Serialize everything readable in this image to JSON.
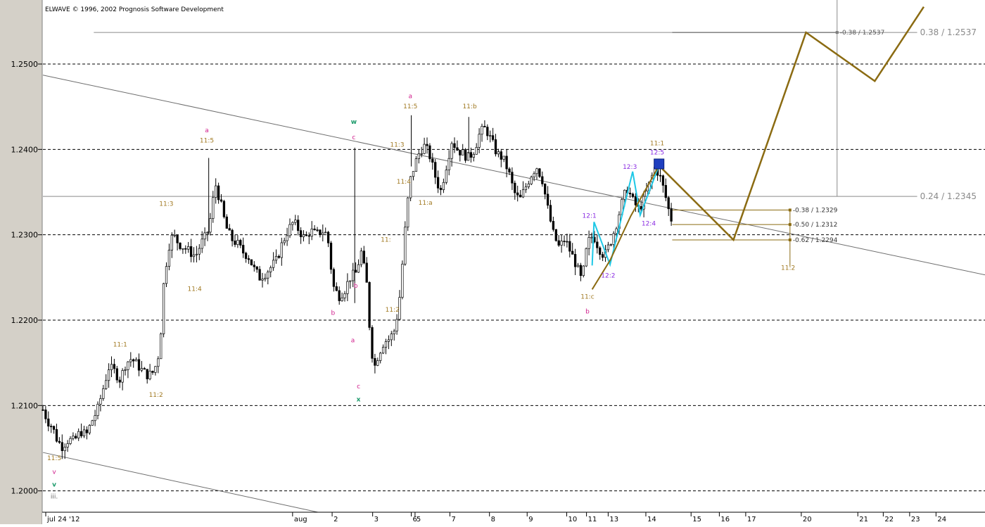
{
  "header": {
    "copyright": "ELWAVE © 1996, 2002 Prognosis Software Development"
  },
  "colors": {
    "candle": "#000000",
    "grid": "#000000",
    "trend": "#6e6e6e",
    "fib": "#8a8a8a",
    "projection": "#8b6b12",
    "impulse_cyan": "#1ec8e6",
    "label_gold": "#a07820",
    "label_magenta": "#d01c8b",
    "label_green": "#1a9a6a",
    "label_purple": "#8a2be2",
    "marker": "#1f3fbf",
    "axis_panel": "#d4d0c8"
  },
  "chart_data": {
    "type": "candlestick",
    "ylim": [
      1.1975,
      1.2575
    ],
    "xlim": [
      0,
      100
    ],
    "grid": "dashed horizontal at y ticks",
    "y_ticks": [
      {
        "value": 1.25,
        "label": "1.2500"
      },
      {
        "value": 1.24,
        "label": "1.2400"
      },
      {
        "value": 1.23,
        "label": "1.2300"
      },
      {
        "value": 1.22,
        "label": "1.2200"
      },
      {
        "value": 1.21,
        "label": "1.2100"
      },
      {
        "value": 1.2,
        "label": "1.2000"
      }
    ],
    "x_ticks": [
      {
        "x": 0.3,
        "label": "jul 24 '12"
      },
      {
        "x": 26.5,
        "label": "aug"
      },
      {
        "x": 30.7,
        "label": "2"
      },
      {
        "x": 35.0,
        "label": "3"
      },
      {
        "x": 39.1,
        "label": "6"
      },
      {
        "x": 39.5,
        "label": "5"
      },
      {
        "x": 43.2,
        "label": "7"
      },
      {
        "x": 47.4,
        "label": "8"
      },
      {
        "x": 51.4,
        "label": "9"
      },
      {
        "x": 55.6,
        "label": "10"
      },
      {
        "x": 57.7,
        "label": "11"
      },
      {
        "x": 60.0,
        "label": "13"
      },
      {
        "x": 64.0,
        "label": "14"
      },
      {
        "x": 68.8,
        "label": "15"
      },
      {
        "x": 71.8,
        "label": "16"
      },
      {
        "x": 74.6,
        "label": "17"
      },
      {
        "x": 80.5,
        "label": "20"
      },
      {
        "x": 86.5,
        "label": "21"
      },
      {
        "x": 89.2,
        "label": "22"
      },
      {
        "x": 92.0,
        "label": "23"
      },
      {
        "x": 94.8,
        "label": "24"
      }
    ],
    "price_path": [
      [
        0.0,
        1.2095
      ],
      [
        0.5,
        1.2082
      ],
      [
        1.0,
        1.2075
      ],
      [
        1.5,
        1.206
      ],
      [
        2.0,
        1.2052
      ],
      [
        2.7,
        1.206
      ],
      [
        3.3,
        1.2058
      ],
      [
        4.0,
        1.207
      ],
      [
        4.6,
        1.2065
      ],
      [
        5.2,
        1.2082
      ],
      [
        5.8,
        1.2095
      ],
      [
        6.4,
        1.212
      ],
      [
        7.0,
        1.2145
      ],
      [
        7.6,
        1.214
      ],
      [
        8.2,
        1.213
      ],
      [
        8.8,
        1.215
      ],
      [
        9.4,
        1.2155
      ],
      [
        10.0,
        1.2148
      ],
      [
        10.6,
        1.214
      ],
      [
        11.2,
        1.2135
      ],
      [
        11.8,
        1.214
      ],
      [
        12.4,
        1.2165
      ],
      [
        12.8,
        1.224
      ],
      [
        13.3,
        1.2285
      ],
      [
        13.8,
        1.23
      ],
      [
        14.4,
        1.229
      ],
      [
        15.0,
        1.2285
      ],
      [
        15.6,
        1.228
      ],
      [
        16.2,
        1.2275
      ],
      [
        16.8,
        1.229
      ],
      [
        17.4,
        1.23
      ],
      [
        17.8,
        1.232
      ],
      [
        18.3,
        1.236
      ],
      [
        18.8,
        1.234
      ],
      [
        19.4,
        1.231
      ],
      [
        20.0,
        1.2295
      ],
      [
        20.6,
        1.229
      ],
      [
        21.2,
        1.228
      ],
      [
        21.8,
        1.2275
      ],
      [
        22.4,
        1.226
      ],
      [
        23.0,
        1.225
      ],
      [
        23.6,
        1.2255
      ],
      [
        24.2,
        1.2262
      ],
      [
        24.8,
        1.227
      ],
      [
        25.4,
        1.229
      ],
      [
        26.0,
        1.2305
      ],
      [
        26.6,
        1.2315
      ],
      [
        27.2,
        1.2305
      ],
      [
        27.8,
        1.2295
      ],
      [
        28.4,
        1.2305
      ],
      [
        29.0,
        1.23
      ],
      [
        29.6,
        1.2305
      ],
      [
        30.2,
        1.23
      ],
      [
        30.8,
        1.224
      ],
      [
        31.4,
        1.2228
      ],
      [
        32.0,
        1.2235
      ],
      [
        32.6,
        1.225
      ],
      [
        33.2,
        1.2255
      ],
      [
        33.8,
        1.228
      ],
      [
        34.4,
        1.224
      ],
      [
        34.8,
        1.217
      ],
      [
        35.2,
        1.2145
      ],
      [
        35.6,
        1.216
      ],
      [
        36.2,
        1.2175
      ],
      [
        36.8,
        1.2178
      ],
      [
        37.4,
        1.219
      ],
      [
        37.9,
        1.223
      ],
      [
        38.4,
        1.23
      ],
      [
        38.9,
        1.236
      ],
      [
        39.4,
        1.238
      ],
      [
        39.9,
        1.2395
      ],
      [
        40.4,
        1.2405
      ],
      [
        41.0,
        1.2395
      ],
      [
        41.6,
        1.237
      ],
      [
        42.2,
        1.235
      ],
      [
        42.8,
        1.238
      ],
      [
        43.4,
        1.241
      ],
      [
        44.0,
        1.24
      ],
      [
        44.6,
        1.2395
      ],
      [
        45.2,
        1.239
      ],
      [
        45.8,
        1.24
      ],
      [
        46.4,
        1.242
      ],
      [
        47.0,
        1.2425
      ],
      [
        47.6,
        1.241
      ],
      [
        48.2,
        1.2395
      ],
      [
        48.8,
        1.239
      ],
      [
        49.4,
        1.2375
      ],
      [
        50.0,
        1.235
      ],
      [
        50.6,
        1.234
      ],
      [
        51.2,
        1.2355
      ],
      [
        51.8,
        1.237
      ],
      [
        52.4,
        1.238
      ],
      [
        53.0,
        1.2365
      ],
      [
        53.6,
        1.233
      ],
      [
        54.2,
        1.23
      ],
      [
        54.8,
        1.2285
      ],
      [
        55.4,
        1.2295
      ],
      [
        56.0,
        1.228
      ],
      [
        56.6,
        1.2265
      ],
      [
        57.2,
        1.2245
      ],
      [
        57.8,
        1.229
      ],
      [
        58.4,
        1.23
      ],
      [
        59.0,
        1.2285
      ],
      [
        59.6,
        1.2275
      ],
      [
        60.2,
        1.229
      ],
      [
        60.8,
        1.231
      ],
      [
        61.4,
        1.2335
      ],
      [
        62.0,
        1.2355
      ],
      [
        62.6,
        1.234
      ],
      [
        63.2,
        1.233
      ],
      [
        63.8,
        1.234
      ],
      [
        64.4,
        1.236
      ],
      [
        65.0,
        1.238
      ],
      [
        65.6,
        1.2365
      ],
      [
        66.2,
        1.234
      ],
      [
        66.6,
        1.232
      ],
      [
        66.9,
        1.2315
      ]
    ],
    "trendlines": [
      {
        "name": "upper",
        "from": [
          0,
          1.2487
        ],
        "to": [
          100,
          1.2253
        ]
      },
      {
        "name": "lower",
        "from": [
          0,
          1.2045
        ],
        "to": [
          29.2,
          1.1975
        ]
      }
    ],
    "fib_levels": [
      {
        "value": 1.2537,
        "label": "0.38 / 1.2537",
        "x_from": 5.4,
        "x_to": 92.8
      },
      {
        "value": 1.2345,
        "label": "0.24 / 1.2345",
        "x_from": 0,
        "x_to": 92.8
      }
    ],
    "fib_projection_top": {
      "value": 1.2537,
      "label": "-0.38 / 1.2537",
      "x_from": 66.8,
      "x_to": 84.3,
      "box_x": 84.3
    },
    "vertical_marker": {
      "x": 84.3,
      "y_from": 1.2575,
      "y_to": 1.2345
    },
    "retracements": [
      {
        "value": 1.2329,
        "label": "-0.38 / 1.2329"
      },
      {
        "value": 1.2312,
        "label": "-0.50 / 1.2312"
      },
      {
        "value": 1.2294,
        "label": "-0.62 / 1.2294"
      }
    ],
    "retracement_span": {
      "x_from": 66.8,
      "x_to": 79.3
    },
    "retracement_bracket": {
      "x": 79.3,
      "y_from": 1.2329,
      "y_to": 1.2263
    },
    "retracement_label": {
      "x": 79.1,
      "y": 1.2259,
      "text": "11:2"
    },
    "projection_path": [
      [
        65.4,
        1.2381
      ],
      [
        73.3,
        1.2294
      ],
      [
        81.0,
        1.2537
      ],
      [
        88.3,
        1.248
      ],
      [
        93.5,
        1.2567
      ]
    ],
    "cyan_path": [
      [
        58.3,
        1.2264
      ],
      [
        58.5,
        1.2315
      ],
      [
        60.2,
        1.2265
      ],
      [
        62.6,
        1.2374
      ],
      [
        63.4,
        1.2323
      ],
      [
        65.4,
        1.2381
      ]
    ],
    "gold_path": [
      [
        58.3,
        1.2236
      ],
      [
        60.2,
        1.227
      ],
      [
        62.4,
        1.2322
      ],
      [
        65.4,
        1.2381
      ]
    ],
    "top_marker": {
      "x": 65.4,
      "y": 1.2383
    },
    "wave_labels": [
      {
        "x": 1.2,
        "y": 1.2036,
        "text": "11:5",
        "color": "gold"
      },
      {
        "x": 1.2,
        "y": 1.202,
        "text": "v",
        "color": "magenta"
      },
      {
        "x": 1.2,
        "y": 1.2005,
        "text": "v",
        "color": "green"
      },
      {
        "x": 1.2,
        "y": 1.1991,
        "text": "iii.",
        "color": "gray"
      },
      {
        "x": 8.2,
        "y": 1.2169,
        "text": "11:1",
        "color": "gold"
      },
      {
        "x": 12.0,
        "y": 1.211,
        "text": "11:2",
        "color": "gold"
      },
      {
        "x": 13.1,
        "y": 1.2334,
        "text": "11:3",
        "color": "gold"
      },
      {
        "x": 16.1,
        "y": 1.2234,
        "text": "11:4",
        "color": "gold"
      },
      {
        "x": 17.4,
        "y": 1.2408,
        "text": "11:5",
        "color": "gold"
      },
      {
        "x": 17.4,
        "y": 1.242,
        "text": "a",
        "color": "magenta"
      },
      {
        "x": 30.8,
        "y": 1.2206,
        "text": "b",
        "color": "magenta"
      },
      {
        "x": 33.0,
        "y": 1.243,
        "text": "w",
        "color": "green"
      },
      {
        "x": 33.0,
        "y": 1.2412,
        "text": "c",
        "color": "magenta"
      },
      {
        "x": 33.2,
        "y": 1.2238,
        "text": "b",
        "color": "magenta"
      },
      {
        "x": 32.9,
        "y": 1.2174,
        "text": "a",
        "color": "magenta"
      },
      {
        "x": 33.5,
        "y": 1.212,
        "text": "c",
        "color": "magenta"
      },
      {
        "x": 33.5,
        "y": 1.2105,
        "text": "x",
        "color": "green"
      },
      {
        "x": 36.4,
        "y": 1.2292,
        "text": "11:",
        "color": "gold"
      },
      {
        "x": 37.1,
        "y": 1.221,
        "text": "11:2",
        "color": "gold"
      },
      {
        "x": 37.6,
        "y": 1.2403,
        "text": "11:3",
        "color": "gold"
      },
      {
        "x": 38.3,
        "y": 1.236,
        "text": "11:4",
        "color": "gold"
      },
      {
        "x": 39.0,
        "y": 1.2448,
        "text": "11:5",
        "color": "gold"
      },
      {
        "x": 39.0,
        "y": 1.246,
        "text": "a",
        "color": "magenta"
      },
      {
        "x": 40.6,
        "y": 1.2335,
        "text": "11:a",
        "color": "gold"
      },
      {
        "x": 45.3,
        "y": 1.2448,
        "text": "11:b",
        "color": "gold"
      },
      {
        "x": 57.8,
        "y": 1.2225,
        "text": "11:c",
        "color": "gold"
      },
      {
        "x": 57.8,
        "y": 1.2208,
        "text": "b",
        "color": "magenta"
      },
      {
        "x": 58.0,
        "y": 1.232,
        "text": "12:1",
        "color": "purple"
      },
      {
        "x": 60.0,
        "y": 1.225,
        "text": "12:2",
        "color": "purple"
      },
      {
        "x": 62.3,
        "y": 1.2377,
        "text": "12:3",
        "color": "purple"
      },
      {
        "x": 64.3,
        "y": 1.2311,
        "text": "12:4",
        "color": "purple"
      },
      {
        "x": 65.2,
        "y": 1.2394,
        "text": "12:5",
        "color": "purple"
      },
      {
        "x": 65.2,
        "y": 1.2405,
        "text": "11:1",
        "color": "gold"
      }
    ]
  }
}
